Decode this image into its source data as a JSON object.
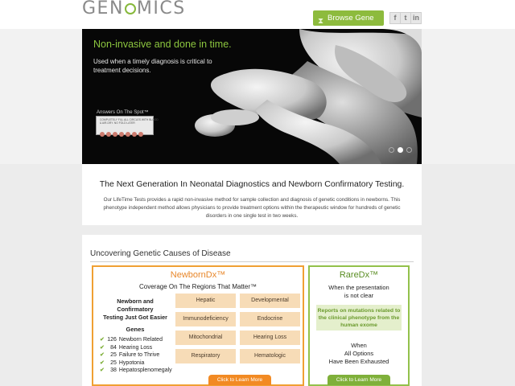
{
  "header": {
    "logo_left": "GEN",
    "logo_right": "MICS",
    "browse_label": "Browse Gene List",
    "dna_icon": "dna-icon",
    "social": [
      {
        "name": "facebook",
        "glyph": "f"
      },
      {
        "name": "twitter",
        "glyph": "t"
      },
      {
        "name": "linkedin",
        "glyph": "in"
      }
    ]
  },
  "hero": {
    "title": "Non-invasive and done in time.",
    "subtitle": "Used when a timely diagnosis is critical to treatment decisions.",
    "badge_title": "Answers On The Spot™",
    "card_line1": "COMPLETELY FILL ALL CIRCLES WITH BLOOD",
    "card_line2": "& AIR-DRY. NO FOLD LATER",
    "slides": 3,
    "active_slide": 2
  },
  "intro": {
    "heading": "The Next Generation In Neonatal Diagnostics and Newborn Confirmatory Testing.",
    "body": "Our LifeTime Tests provides a rapid non-invasive method for sample collection and diagnosis of genetic conditions in newborns.  This phenotype independent method allows physicians to provide treatment options within the therapeutic window for hundreds of genetic disorders in one single test in two weeks."
  },
  "section": {
    "heading": "Uncovering Genetic Causes of Disease"
  },
  "newborn": {
    "title": "NewbornDx™",
    "coverage": "Coverage On The Regions That Matter™",
    "tagline_1": "Newborn and Confirmatory",
    "tagline_2": "Testing Just Got Easier",
    "genes_heading": "Genes",
    "genes": [
      {
        "count": "126",
        "label": "Newborn Related"
      },
      {
        "count": "84",
        "label": "Hearing Loss"
      },
      {
        "count": "25",
        "label": "Failure to Thrive"
      },
      {
        "count": "25",
        "label": "Hypotonia"
      },
      {
        "count": "38",
        "label": "Hepatosplenomegaly"
      }
    ],
    "categories": [
      "Hepatic",
      "Developmental",
      "Immunodeficiency",
      "Endocrine",
      "Mitochondrial",
      "Hearing Loss",
      "Respiratory",
      "Hematologic"
    ],
    "cta": "Click to Learn More",
    "accent": "#f0a033"
  },
  "rare": {
    "title": "RareDx™",
    "when_1": "When the presentation",
    "when_2": "is not clear",
    "report": "Reports on mutations related to the clinical phenotype from the human exome",
    "when2_1": "When",
    "when2_2": "All Options",
    "when2_3": "Have Been Exhausted",
    "cta": "Click to Learn More",
    "accent": "#93c14b"
  }
}
